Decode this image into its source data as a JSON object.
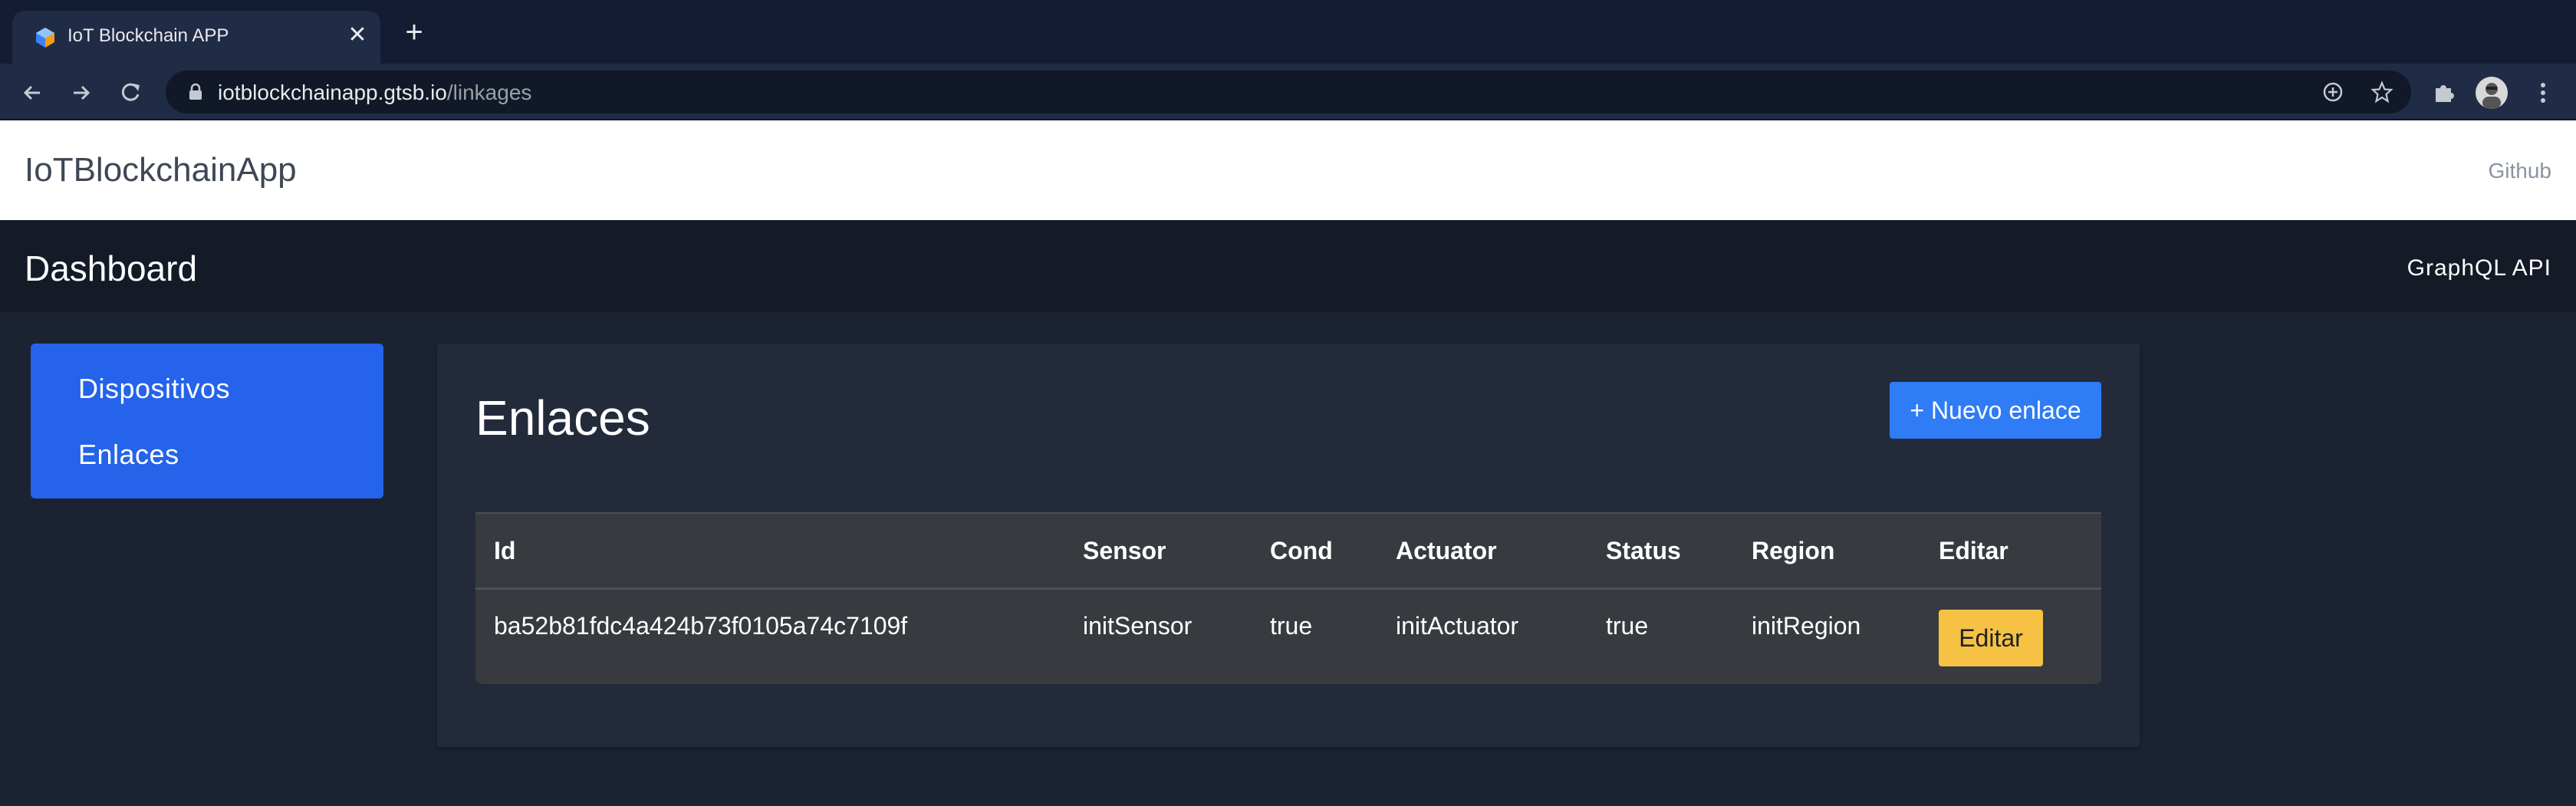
{
  "browser": {
    "tab_title": "IoT Blockchain APP",
    "tab_close": "✕",
    "new_tab": "+",
    "url_host": "iotblockchainapp.gtsb.io",
    "url_path": "/linkages"
  },
  "app": {
    "brand": "IoTBlockchainApp",
    "github_link": "Github"
  },
  "dashboard": {
    "title": "Dashboard",
    "graphql_link": "GraphQL API"
  },
  "sidebar": {
    "items": [
      {
        "label": "Dispositivos"
      },
      {
        "label": "Enlaces"
      }
    ]
  },
  "main": {
    "title": "Enlaces",
    "new_button": "+ Nuevo enlace",
    "table": {
      "headers": [
        "Id",
        "Sensor",
        "Cond",
        "Actuator",
        "Status",
        "Region",
        "Editar"
      ],
      "rows": [
        {
          "id": "ba52b81fdc4a424b73f0105a74c7109f",
          "sensor": "initSensor",
          "cond": "true",
          "actuator": "initActuator",
          "status": "true",
          "region": "initRegion",
          "edit_label": "Editar"
        }
      ]
    }
  },
  "colors": {
    "primary": "#2563eb",
    "button_primary": "#2f7cf6",
    "button_warning": "#f6c244",
    "page_bg": "#1b2333"
  }
}
